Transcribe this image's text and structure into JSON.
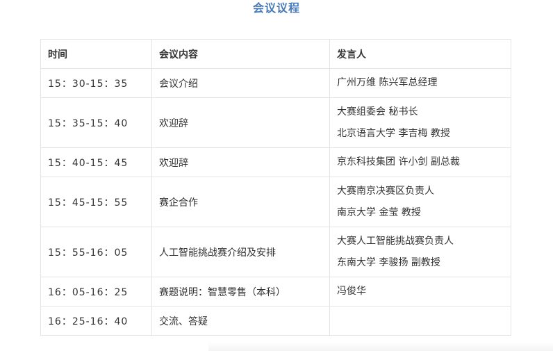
{
  "title": "会议议程",
  "headers": {
    "time": "时间",
    "content": "会议内容",
    "speaker": "发言人"
  },
  "rows": [
    {
      "time": "15：30-15：35",
      "content": "会议介绍",
      "speakers": [
        "广州万维  陈兴军总经理"
      ]
    },
    {
      "time": "15：35-15：40",
      "content": "欢迎辞",
      "speakers": [
        "大赛组委会 秘书长",
        "北京语言大学 李吉梅 教授"
      ]
    },
    {
      "time": "15：40-15：45",
      "content": "欢迎辞",
      "speakers": [
        "京东科技集团 许小剑 副总裁"
      ]
    },
    {
      "time": "15：45-15：55",
      "content": "赛企合作",
      "speakers": [
        "大赛南京决赛区负责人",
        "南京大学 金莹 教授"
      ]
    },
    {
      "time": "15：55-16：05",
      "content": "人工智能挑战赛介绍及安排",
      "speakers": [
        "大赛人工智能挑战赛负责人",
        "东南大学 李骏扬 副教授"
      ]
    },
    {
      "time": "16：05-16：25",
      "content": "赛题说明：智慧零售（本科）",
      "speakers": [
        "冯俊华"
      ]
    },
    {
      "time": "16：25-16：40",
      "content": "交流、答疑",
      "speakers": []
    }
  ]
}
